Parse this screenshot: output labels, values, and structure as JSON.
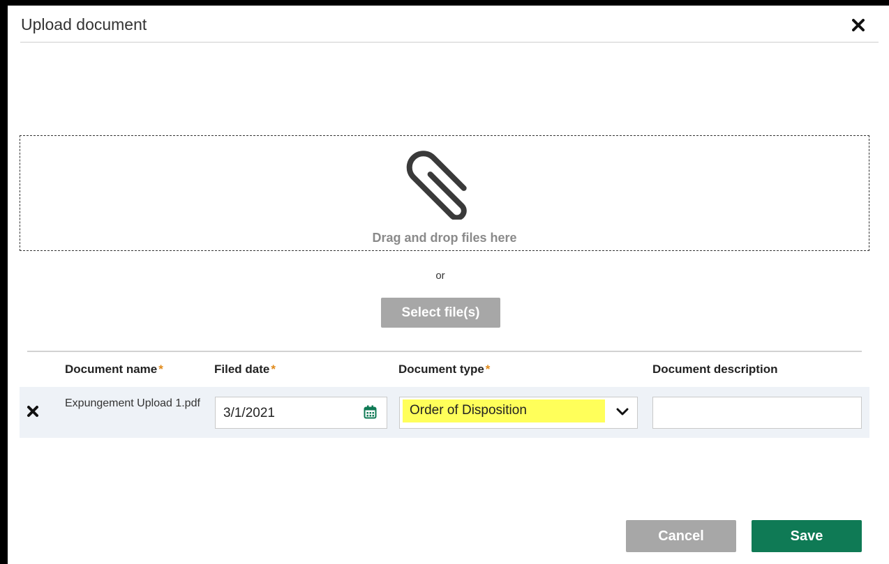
{
  "dialog": {
    "title": "Upload document",
    "close_icon": "close-icon"
  },
  "dropzone": {
    "icon": "paperclip-icon",
    "text": "Drag and drop files here",
    "or_text": "or",
    "select_button": "Select file(s)"
  },
  "table": {
    "columns": [
      {
        "label": "Document name",
        "required": true
      },
      {
        "label": "Filed date",
        "required": true
      },
      {
        "label": "Document type",
        "required": true
      },
      {
        "label": "Document description",
        "required": false
      }
    ],
    "required_mark": "*",
    "rows": [
      {
        "remove_icon": "close-icon",
        "name": "Expungement Upload 1.pdf",
        "filed_date": "3/1/2021",
        "document_type": "Order of Disposition",
        "description": ""
      }
    ]
  },
  "footer": {
    "cancel_label": "Cancel",
    "save_label": "Save"
  },
  "colors": {
    "save": "#0f7a55",
    "disabled": "#a7a7a7",
    "required_star": "#e08a1a",
    "highlight": "#ffff5a",
    "calendar_icon": "#0f7a55"
  }
}
